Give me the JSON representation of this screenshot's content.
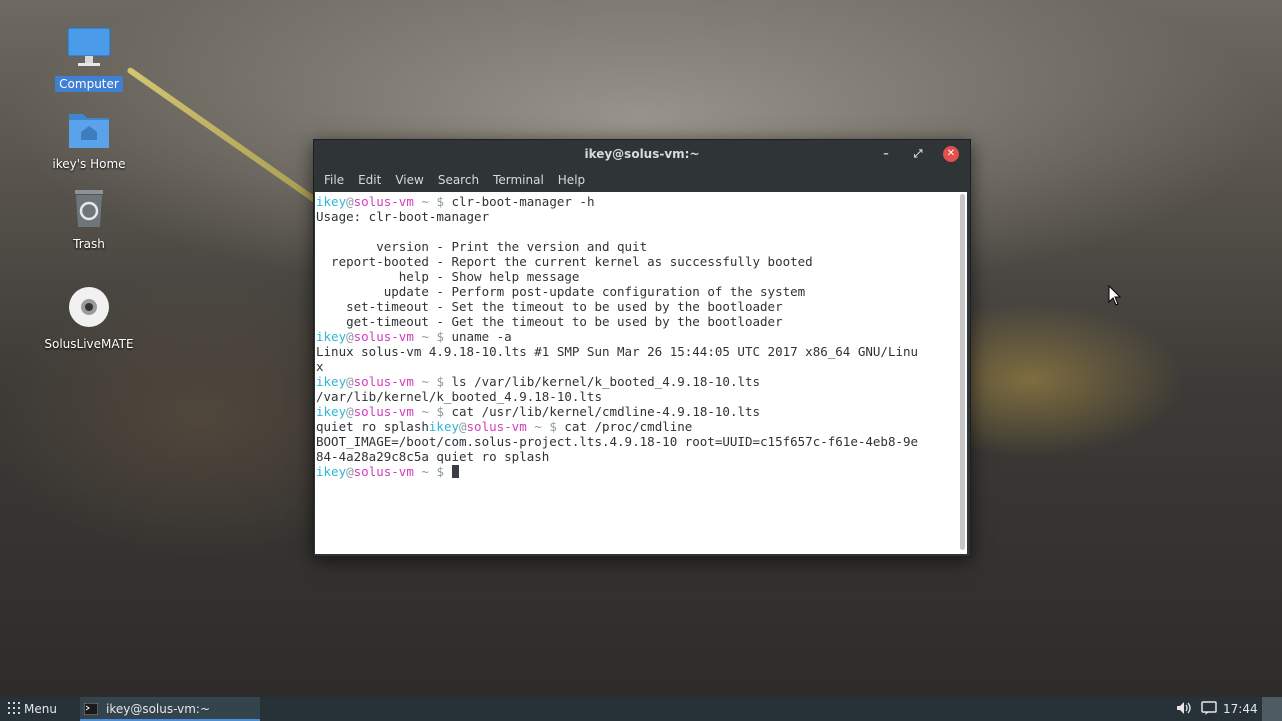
{
  "desktop": {
    "icons": [
      {
        "label": "Computer",
        "icon": "computer-icon"
      },
      {
        "label": "ikey's Home",
        "icon": "home-folder-icon"
      },
      {
        "label": "Trash",
        "icon": "trash-icon"
      },
      {
        "label": "SolusLiveMATE",
        "icon": "disc-icon"
      }
    ]
  },
  "window": {
    "title": "ikey@solus-vm:~",
    "minimize": "–",
    "maximize": "⤢",
    "close": "✕",
    "menu": [
      "File",
      "Edit",
      "View",
      "Search",
      "Terminal",
      "Help"
    ]
  },
  "terminal": {
    "user": "ikey",
    "at": "@",
    "host": "solus-vm",
    "prompt_sym": "~ $",
    "cmd1": "clr-boot-manager -h",
    "out1": "Usage: clr-boot-manager\n\n        version - Print the version and quit\n  report-booted - Report the current kernel as successfully booted\n           help - Show help message\n         update - Perform post-update configuration of the system\n    set-timeout - Set the timeout to be used by the bootloader\n    get-timeout - Get the timeout to be used by the bootloader",
    "cmd2": "uname -a",
    "out2": "Linux solus-vm 4.9.18-10.lts #1 SMP Sun Mar 26 15:44:05 UTC 2017 x86_64 GNU/Linu\nx",
    "cmd3": "ls /var/lib/kernel/k_booted_4.9.18-10.lts",
    "out3": "/var/lib/kernel/k_booted_4.9.18-10.lts",
    "cmd4": "cat /usr/lib/kernel/cmdline-4.9.18-10.lts",
    "out4": "quiet ro splash",
    "cmd5": "cat /proc/cmdline",
    "out5": "BOOT_IMAGE=/boot/com.solus-project.lts.4.9.18-10 root=UUID=c15f657c-f61e-4eb8-9e\n84-4a28a29c8c5a quiet ro splash"
  },
  "taskbar": {
    "menu_label": "Menu",
    "task_label": "ikey@solus-vm:~",
    "clock": "17:44"
  },
  "colors": {
    "user": "#2eb6d6",
    "host": "#d23ebd",
    "taskbar": "#263238",
    "close_button": "#e0504e"
  }
}
